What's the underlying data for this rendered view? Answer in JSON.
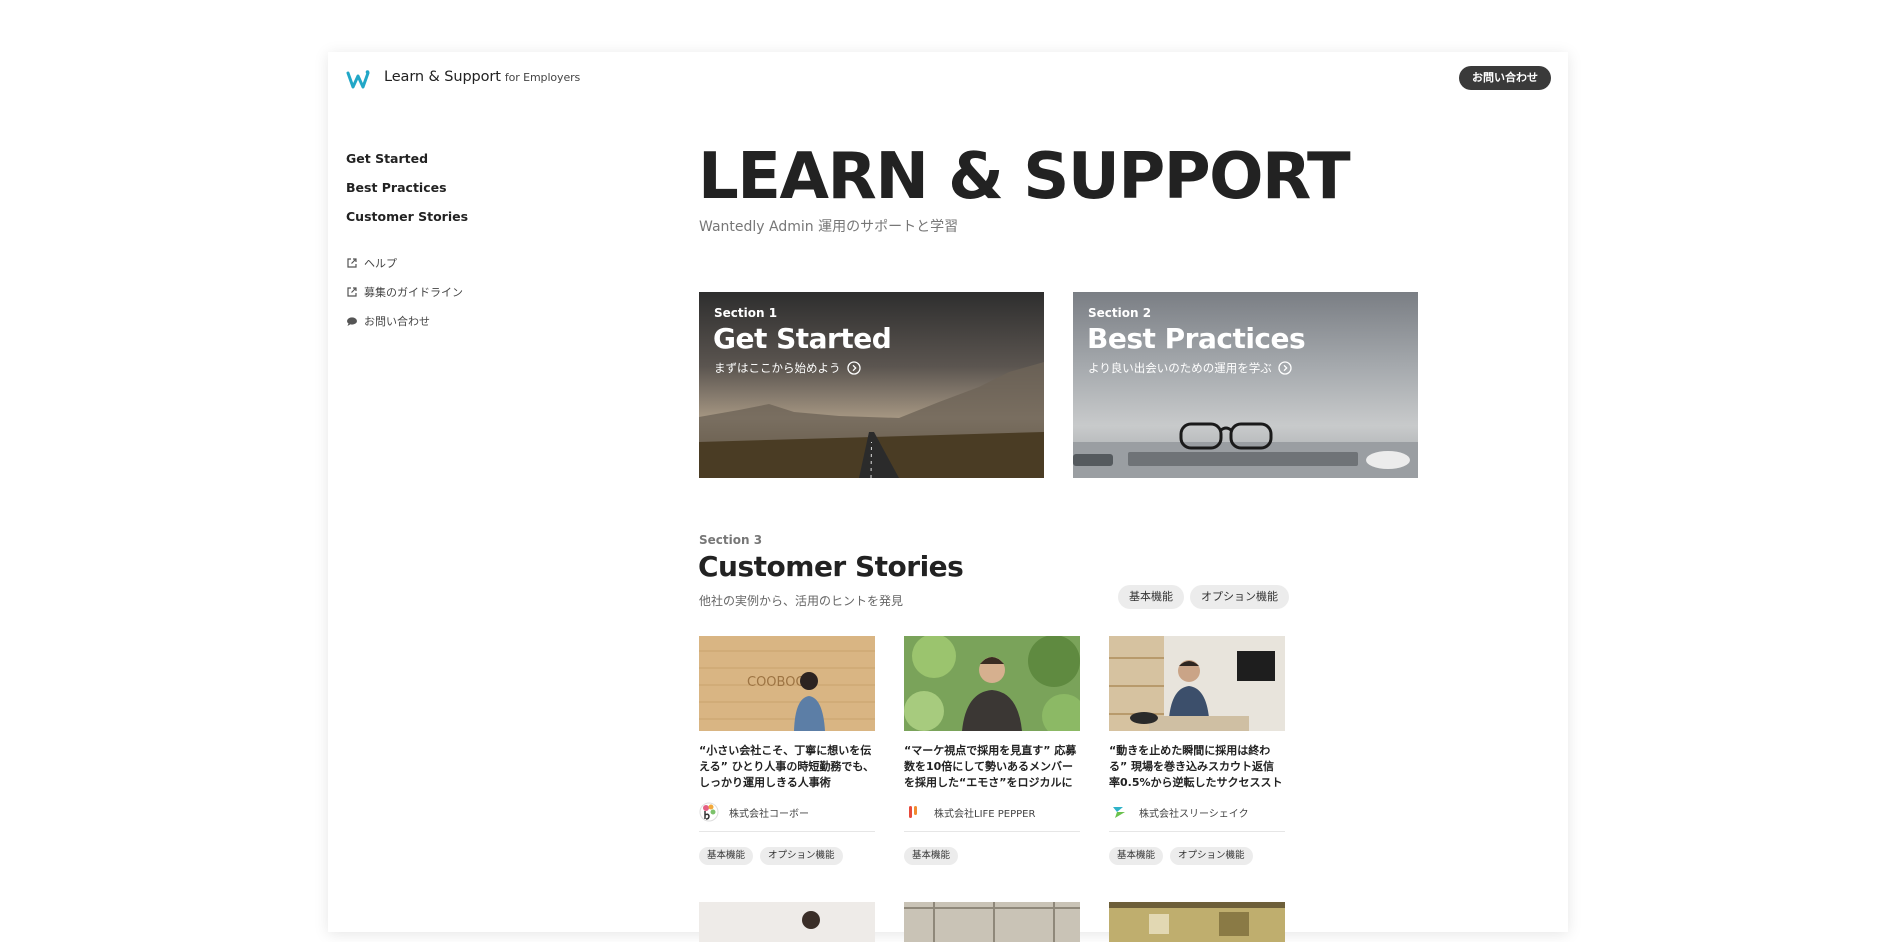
{
  "header": {
    "brand": "Learn & Support",
    "brand_sub": "for Employers",
    "contact_button": "お問い合わせ"
  },
  "sidebar": {
    "main_items": [
      {
        "label": "Get Started"
      },
      {
        "label": "Best Practices"
      },
      {
        "label": "Customer Stories"
      }
    ],
    "sub_items": [
      {
        "label": "ヘルプ",
        "icon": "external-link-icon"
      },
      {
        "label": "募集のガイドライン",
        "icon": "external-link-icon"
      },
      {
        "label": "お問い合わせ",
        "icon": "chat-bubble-icon"
      }
    ]
  },
  "hero": {
    "title": "LEARN & SUPPORT",
    "subtitle": "Wantedly Admin 運用のサポートと学習"
  },
  "sections": [
    {
      "section": "Section 1",
      "title": "Get Started",
      "description": "まずはここから始めよう"
    },
    {
      "section": "Section 2",
      "title": "Best Practices",
      "description": "より良い出会いのための運用を学ぶ"
    }
  ],
  "customer_stories": {
    "section": "Section 3",
    "title": "Customer Stories",
    "subtitle": "他社の実例から、活用のヒントを発見",
    "filters": [
      "基本機能",
      "オプション機能"
    ],
    "stories": [
      {
        "title": "“小さい会社こそ、丁寧に想いを伝える” ひとり人事の時短勤務でも、しっかり運用しきる人事術",
        "company": "株式会社コーボー",
        "tags": [
          "基本機能",
          "オプション機能"
        ]
      },
      {
        "title": "“マーケ視点で採用を見直す” 応募数を10倍にして勢いあるメンバーを採用した“エモさ”をロジカルに伝える術",
        "company": "株式会社LIFE PEPPER",
        "tags": [
          "基本機能"
        ]
      },
      {
        "title": "“動きを止めた瞬間に採用は終わる” 現場を巻き込みスカウト返信率0.5%から逆転したサクセスストーリー",
        "company": "株式会社スリーシェイク",
        "tags": [
          "基本機能",
          "オプション機能"
        ]
      }
    ]
  },
  "colors": {
    "accent": "#21a7c7",
    "button_dark": "#3a3a3a",
    "tag_bg": "#ececec"
  }
}
